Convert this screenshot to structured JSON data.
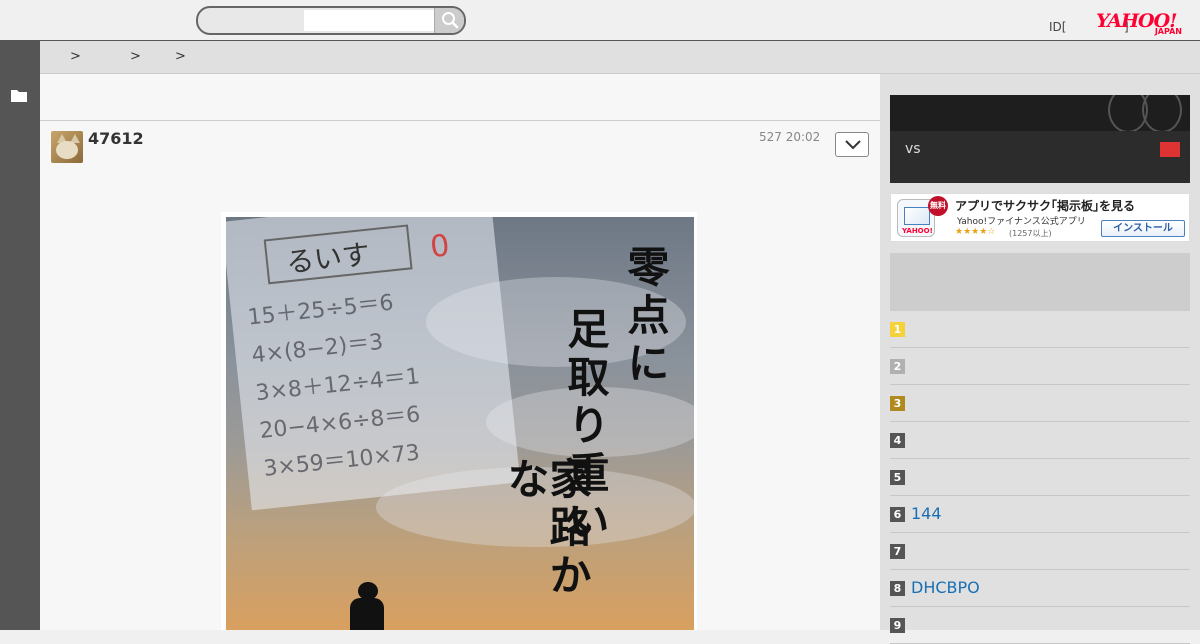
{
  "header": {
    "search_placeholder": "",
    "id_link": "ID[",
    "help_mark": "]",
    "logo_text": "YAHOO!",
    "logo_sub": "JAPAN"
  },
  "breadcrumb": [
    ">",
    ">",
    ">"
  ],
  "post": {
    "username": "47612",
    "timestamp": "527 20:02",
    "image": {
      "vertical_text": [
        "零点に",
        "足取り重い",
        "家路かな"
      ],
      "test_name": "るいす",
      "test_lines": [
        "15＋25÷5＝6",
        "4×(8−2)＝3",
        "3×8＋12÷4＝1",
        "20−4×6÷8＝6",
        "3×59＝10×73"
      ]
    }
  },
  "sidebar": {
    "score": {
      "label": "vs"
    },
    "ad": {
      "badge": "無料",
      "title": "アプリでサクサク｢掲示板｣を見る",
      "subtitle": "Yahoo!ファイナンス公式アプリ",
      "stars": "★★★★☆",
      "count": "(1257以上)",
      "install_label": "インストール",
      "icon_logo": "YAHOO!"
    },
    "ranking": [
      {
        "num": "1",
        "text": "",
        "color": "#f4d23c"
      },
      {
        "num": "2",
        "text": "",
        "color": "#b0b0b0"
      },
      {
        "num": "3",
        "text": "",
        "color": "#b08a1e"
      },
      {
        "num": "4",
        "text": "",
        "color": "#555555"
      },
      {
        "num": "5",
        "text": "",
        "color": "#555555"
      },
      {
        "num": "6",
        "text": "144",
        "color": "#555555"
      },
      {
        "num": "7",
        "text": "",
        "color": "#555555"
      },
      {
        "num": "8",
        "text": "DHCBPO",
        "color": "#555555"
      },
      {
        "num": "9",
        "text": "",
        "color": "#555555"
      }
    ]
  }
}
